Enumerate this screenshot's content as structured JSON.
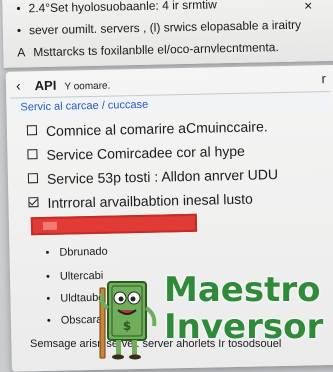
{
  "top": {
    "lines": [
      {
        "bullet": "•",
        "text": "2.4°Set hyolosuobaanle: 4 ir srmtiw"
      },
      {
        "bullet": "•",
        "text": "sever oumilt. servers , (l) srwics elopasable a iraitry"
      },
      {
        "bullet": "A",
        "text": "Msttarcks ts foxilanblle el/oco-arnvlecntmenta."
      }
    ],
    "close_glyph": "×"
  },
  "panel": {
    "back_glyph": "‹",
    "title": "API",
    "subtitle": "Y oomare.",
    "corner_glyph": "r",
    "select_label": "Servic al carcae / cuccase",
    "options": [
      {
        "label": "Comnice al comarire aCmuinccaire.",
        "checked": false
      },
      {
        "label": "Service Comircadee cor al hype",
        "checked": false
      },
      {
        "label": "Service 53p tosti : Alldon anrver UDU",
        "checked": false
      },
      {
        "label": "Intrroral arvailbabtion inesal lusto",
        "checked": true
      }
    ],
    "list": [
      {
        "bullet": "•",
        "text": "Dbrunado"
      },
      {
        "bullet": "•",
        "text": "Ultercabi"
      },
      {
        "bullet": "•",
        "text": "Uldtaubc"
      },
      {
        "bullet": "•",
        "text": "Obscara"
      }
    ],
    "footer": "Semsage arisn server. server ahorlets Ir tosodsouel"
  },
  "brand": {
    "line1": "Maestro",
    "line2": "Inversor",
    "color": "#2f8a3a"
  },
  "colors": {
    "accent_blue": "#2a56c4",
    "error_red": "#e03b35"
  },
  "icons": {
    "mascot": "banknote-mascot-icon"
  }
}
